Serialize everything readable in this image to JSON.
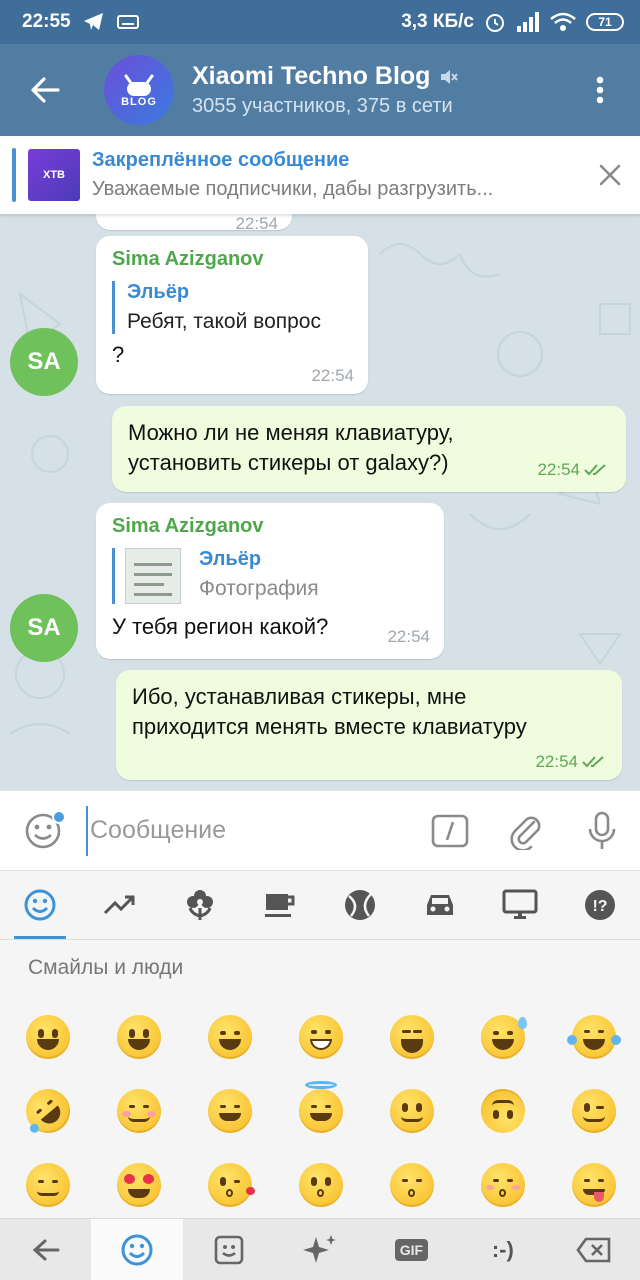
{
  "status_bar": {
    "time": "22:55",
    "speed": "3,3 КБ/с",
    "battery": "71"
  },
  "header": {
    "title": "Xiaomi Techno Blog",
    "subtitle": "3055 участников, 375 в сети",
    "avatar_text": "BLOG"
  },
  "pinned": {
    "title": "Закреплённое сообщение",
    "preview": "Уважаемые подписчики, дабы разгрузить...",
    "thumb_text": "XTB"
  },
  "messages": [
    {
      "time": "22:54"
    },
    {
      "sender": "Sima Azizganov",
      "avatar": "SA",
      "reply_name": "Эльёр",
      "reply_text": "Ребят, такой вопрос",
      "text": "?",
      "time": "22:54"
    },
    {
      "text_line1": "Можно ли не меняя клавиатуру,",
      "text_line2": "установить стикеры от galaxy?)",
      "time": "22:54"
    },
    {
      "sender": "Sima Azizganov",
      "avatar": "SA",
      "reply_name": "Эльёр",
      "reply_text": "Фотография",
      "text": "У тебя регион какой?",
      "time": "22:54"
    },
    {
      "text_line1": "Ибо, устанавливая стикеры, мне",
      "text_line2": "приходится менять вместе клавиатуру",
      "time": "22:54"
    }
  ],
  "input": {
    "placeholder": "Сообщение",
    "command_key": "/"
  },
  "emoji_panel": {
    "section_title": "Смайлы и люди",
    "tabs": [
      "smile-icon",
      "trending-icon",
      "flower-icon",
      "coffee-icon",
      "ball-icon",
      "car-icon",
      "monitor-icon",
      "symbols-icon"
    ],
    "bottom_bar": {
      "gif_label": "GIF",
      "emoticon_label": ":-)"
    }
  },
  "colors": {
    "header": "#527da3",
    "statusbar": "#3f6e9a",
    "chat_bg": "#d5e0e7",
    "incoming": "#ffffff",
    "outgoing": "#effdde",
    "sender": "#4ea84a",
    "accent": "#3d93d8"
  }
}
